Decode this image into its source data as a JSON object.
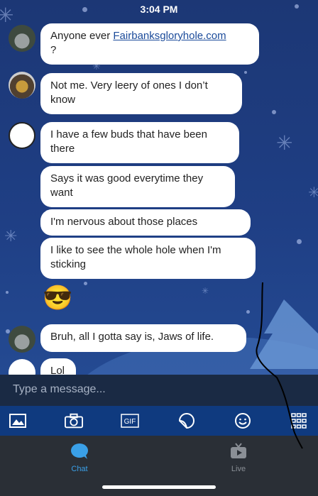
{
  "status_bar": {
    "time": "3:04 PM"
  },
  "messages": [
    {
      "text": "Anyone ever ",
      "link": "Fairbanksgloryhole.com",
      "text_after": "?"
    },
    {
      "text": "Not me. Very leery of ones I don’t know"
    },
    {
      "text": "I have a few buds that have been there"
    },
    {
      "text": "Says it was good everytime they want"
    },
    {
      "text": "I'm nervous about those places"
    },
    {
      "text": "I like to see the whole hole when I'm sticking"
    },
    {
      "emoji": "😎"
    },
    {
      "text": "Bruh, all I gotta say is, Jaws of life."
    },
    {
      "text": "Lol"
    }
  ],
  "input": {
    "placeholder": "Type a message..."
  },
  "toolbar": {
    "items": [
      "image-icon",
      "camera-icon",
      "gif-icon",
      "sticker-icon",
      "emoji-icon",
      "apps-grid-icon"
    ],
    "gif_label": "GIF"
  },
  "tabs": [
    {
      "label": "Chat",
      "icon": "chat-bubble-icon",
      "active": true,
      "color": "#3aa0e8"
    },
    {
      "label": "Live",
      "icon": "live-tv-icon",
      "active": false,
      "color": "#8a8f96"
    }
  ]
}
